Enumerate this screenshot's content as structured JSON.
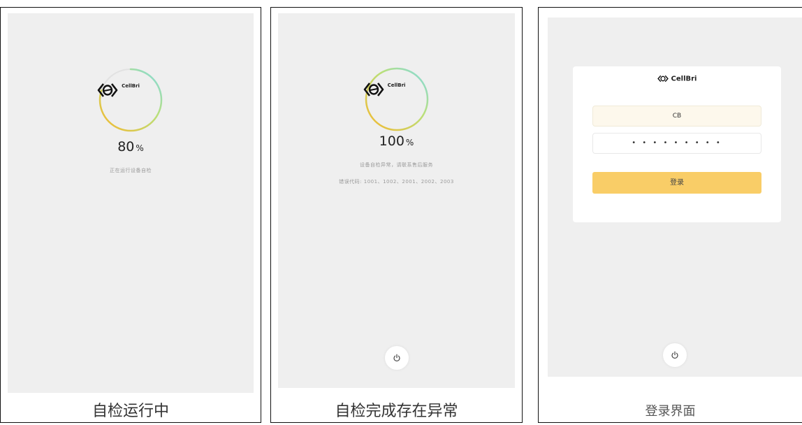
{
  "panels": [
    {
      "caption": "自检运行中",
      "brand": "CellBri",
      "progress_value": "80",
      "progress_unit": "%",
      "progress_fraction": 0.8,
      "status": "正在运行设备自检"
    },
    {
      "caption": "自检完成存在异常",
      "brand": "CellBri",
      "progress_value": "100",
      "progress_unit": "%",
      "progress_fraction": 1.0,
      "status": "设备自检异常，请联系售后服务",
      "error_codes": "错误代码: 1001、1002、2001、2002、2003"
    },
    {
      "caption": "登录界面",
      "brand": "CellBri",
      "username_value": "CB",
      "password_mask": "• • • • • • • • •",
      "login_label": "登录"
    }
  ],
  "colors": {
    "screen_bg": "#efefef",
    "login_button": "#f9cd67",
    "ring_start": "#f5b82e",
    "ring_end": "#7fd9e8"
  },
  "icons": [
    "cellbri-logo-icon",
    "power-icon"
  ]
}
